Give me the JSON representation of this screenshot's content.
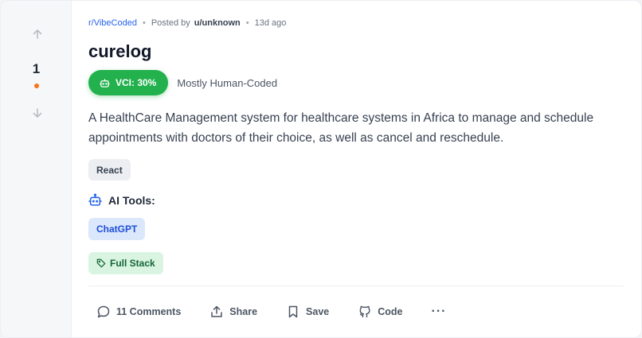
{
  "post": {
    "subreddit": "r/VibeCoded",
    "posted_by_label": "Posted by",
    "author": "u/unknown",
    "age": "13d ago",
    "title": "curelog",
    "vci_label": "VCI: 30%",
    "vci_description": "Mostly Human-Coded",
    "description": "A HealthCare Management system for healthcare systems in Africa to manage and schedule appointments with doctors of their choice, as well as cancel and reschedule.",
    "tech_tags": [
      "React"
    ],
    "ai_tools_label": "AI Tools:",
    "ai_tools": [
      "ChatGPT"
    ],
    "category": "Full Stack",
    "vci_percent": 30
  },
  "votes": {
    "count": "1",
    "up_icon": "arrow-up-icon",
    "down_icon": "arrow-down-icon"
  },
  "actions": {
    "comments": "11 Comments",
    "share": "Share",
    "save": "Save",
    "code": "Code",
    "more": "···"
  },
  "colors": {
    "accent_blue": "#2563eb",
    "vci_green": "#22b14c",
    "vote_dot": "#f97316"
  }
}
